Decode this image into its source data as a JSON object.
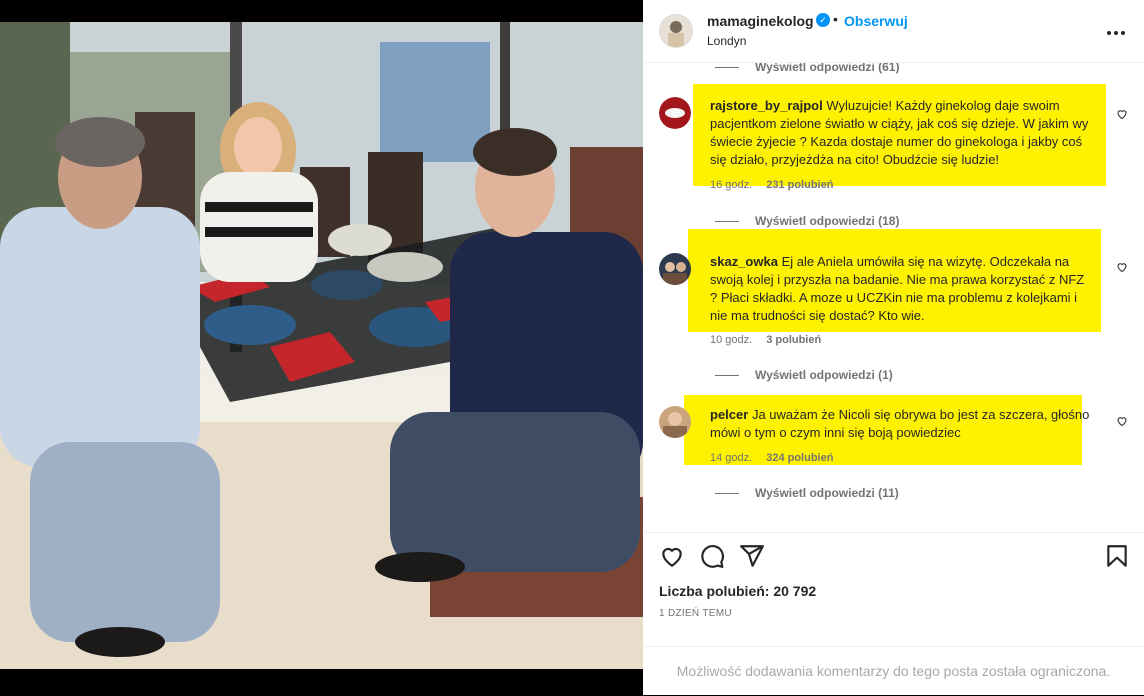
{
  "post": {
    "username": "mamaginekolog",
    "verified_icon": "verified-badge-icon",
    "separator": "•",
    "follow_label": "Obserwuj",
    "location": "Londyn",
    "more_icon": "more-options-icon"
  },
  "comments": {
    "view_replies_top": "Wyświetl odpowiedzi (61)",
    "items": [
      {
        "username": "rajstore_by_rajpol",
        "text": "Wyluzujcie! Każdy ginekolog daje swoim pacjentkom zielone światło w ciąży, jak coś się dzieje. W jakim wy świecie żyjecie ? Kazda dostaje numer do ginekologa i jakby coś się działo, przyjeżdża na cito! Obudźcie się ludzie!",
        "time": "16 godz.",
        "likes": "231 polubień",
        "view_replies": "Wyświetl odpowiedzi (18)"
      },
      {
        "username": "skaz_owka",
        "text": "Ej ale Aniela umówiła się na wizytę. Odczekała na swoją kolej i przyszła na badanie. Nie ma prawa korzystać z NFZ ? Płaci składki. A moze u UCZKin nie ma problemu z kolejkami i nie ma trudności się dostać? Kto wie.",
        "time": "10 godz.",
        "likes": "3 polubień",
        "view_replies": "Wyświetl odpowiedzi (1)"
      },
      {
        "username": "pelcer",
        "text": "Ja uważam że Nicoli się obrywa bo jest za szczera, głośno mówi o tym o czym inni się boją powiedziec",
        "time": "14 godz.",
        "likes": "324 polubień",
        "view_replies": "Wyświetl odpowiedzi (11)"
      }
    ]
  },
  "actions": {
    "like_icon": "heart-icon",
    "comment_icon": "comment-icon",
    "share_icon": "share-icon",
    "save_icon": "bookmark-icon",
    "likes_label": "Liczba polubień: 20 792",
    "date": "1 DZIEŃ TEMU"
  },
  "footer": {
    "comments_limited": "Możliwość dodawania komentarzy do tego posta została ograniczona."
  },
  "colors": {
    "highlight": "#fff200",
    "link": "#0095f6",
    "text": "#262626",
    "muted": "#737373"
  }
}
